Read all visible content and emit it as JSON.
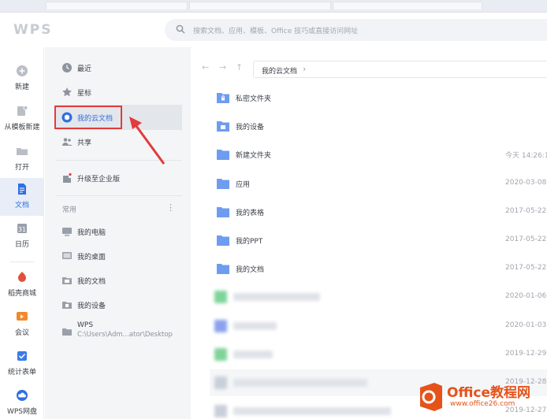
{
  "app": {
    "logo_text": "WPS"
  },
  "search": {
    "placeholder": "搜索文档、应用、模板、Office 技巧或直接访问网址"
  },
  "rail": [
    {
      "label": "新建",
      "icon": "plus-circle-icon"
    },
    {
      "label": "从模板新建",
      "icon": "template-icon"
    },
    {
      "label": "打开",
      "icon": "folder-open-icon"
    },
    {
      "label": "文档",
      "icon": "document-icon",
      "active": true
    },
    {
      "label": "日历",
      "icon": "calendar-icon"
    },
    {
      "label": "稻壳商城",
      "icon": "store-icon"
    },
    {
      "label": "会议",
      "icon": "meeting-icon"
    },
    {
      "label": "统计表单",
      "icon": "form-icon"
    },
    {
      "label": "WPS网盘",
      "icon": "cloud-icon"
    }
  ],
  "nav": {
    "items": [
      {
        "label": "最近",
        "icon": "clock-icon"
      },
      {
        "label": "星标",
        "icon": "star-icon"
      },
      {
        "label": "我的云文档",
        "icon": "cloud-doc-icon",
        "active": true
      },
      {
        "label": "共享",
        "icon": "share-people-icon"
      }
    ],
    "upgrade": "升级至企业版",
    "section_title": "常用",
    "section_more": "⋮",
    "common": [
      {
        "label": "我的电脑",
        "icon": "computer-icon"
      },
      {
        "label": "我的桌面",
        "icon": "desktop-icon"
      },
      {
        "label": "我的文档",
        "icon": "folder-doc-icon"
      },
      {
        "label": "我的设备",
        "icon": "device-icon"
      },
      {
        "label": "WPS",
        "sub": "C:\\Users\\Adm...ator\\Desktop",
        "icon": "folder-icon"
      }
    ]
  },
  "main": {
    "breadcrumb": "我的云文档",
    "breadcrumb_chevron": "›",
    "back": "←",
    "forward": "→",
    "up": "↑",
    "rows": [
      {
        "name": "私密文件夹",
        "date": "",
        "icon": "lock-folder-icon"
      },
      {
        "name": "我的设备",
        "date": "",
        "icon": "device-folder-icon"
      },
      {
        "name": "新建文件夹",
        "date": "今天 14:26:1",
        "icon": "folder-icon"
      },
      {
        "name": "应用",
        "date": "2020-03-08",
        "icon": "folder-icon"
      },
      {
        "name": "我的表格",
        "date": "2017-05-22",
        "icon": "folder-icon"
      },
      {
        "name": "我的PPT",
        "date": "2017-05-22",
        "icon": "folder-icon"
      },
      {
        "name": "我的文档",
        "date": "2017-05-22",
        "icon": "folder-icon"
      },
      {
        "name": "",
        "date": "2020-01-06",
        "icon": "file-icon"
      },
      {
        "name": "",
        "date": "2020-01-03",
        "icon": "file-icon"
      },
      {
        "name": "",
        "date": "2019-12-29",
        "icon": "file-icon"
      },
      {
        "name": "",
        "date": "2019-12-28",
        "icon": "file-icon"
      },
      {
        "name": "",
        "date": "2019-12-27",
        "icon": "file-icon"
      }
    ]
  },
  "watermark": {
    "title": "Office教程网",
    "url": "www.office26.com"
  },
  "colors": {
    "accent": "#2f6fe4",
    "folder": "#6e9cf0",
    "highlight": "#e23b3b",
    "watermark": "#e5531a"
  }
}
